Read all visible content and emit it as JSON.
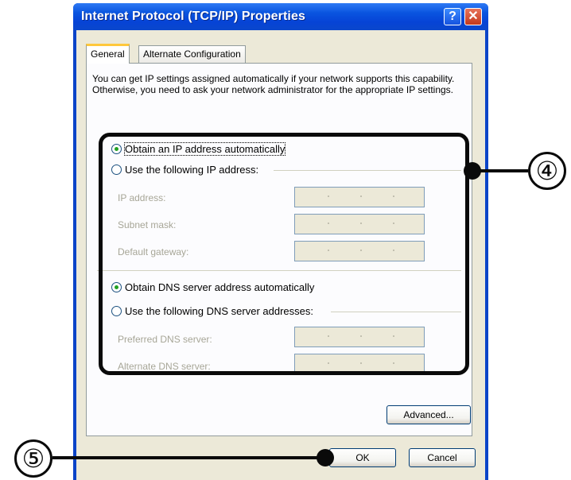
{
  "window": {
    "title": "Internet Protocol (TCP/IP) Properties",
    "help_label": "?",
    "close_label": "✕"
  },
  "tabs": [
    {
      "label": "General",
      "active": true
    },
    {
      "label": "Alternate Configuration",
      "active": false
    }
  ],
  "intro_text": "You can get IP settings assigned automatically if your network supports this capability. Otherwise, you need to ask your network administrator for the appropriate IP settings.",
  "ip_section": {
    "auto_label": "Obtain an IP address automatically",
    "manual_label": "Use the following IP address:",
    "selected": "auto",
    "fields": [
      {
        "label": "IP address:",
        "value": ""
      },
      {
        "label": "Subnet mask:",
        "value": ""
      },
      {
        "label": "Default gateway:",
        "value": ""
      }
    ]
  },
  "dns_section": {
    "auto_label": "Obtain DNS server address automatically",
    "manual_label": "Use the following DNS server addresses:",
    "selected": "auto",
    "fields": [
      {
        "label": "Preferred DNS server:",
        "value": ""
      },
      {
        "label": "Alternate DNS server:",
        "value": ""
      }
    ]
  },
  "buttons": {
    "advanced": "Advanced...",
    "ok": "OK",
    "cancel": "Cancel"
  },
  "callouts": {
    "four": "④",
    "five": "⑤"
  },
  "colors": {
    "title_bar": "#0a55e0",
    "dialog_bg": "#ece9d8",
    "active_tab_accent": "#ffc83c",
    "radio_selected": "#21a121"
  }
}
